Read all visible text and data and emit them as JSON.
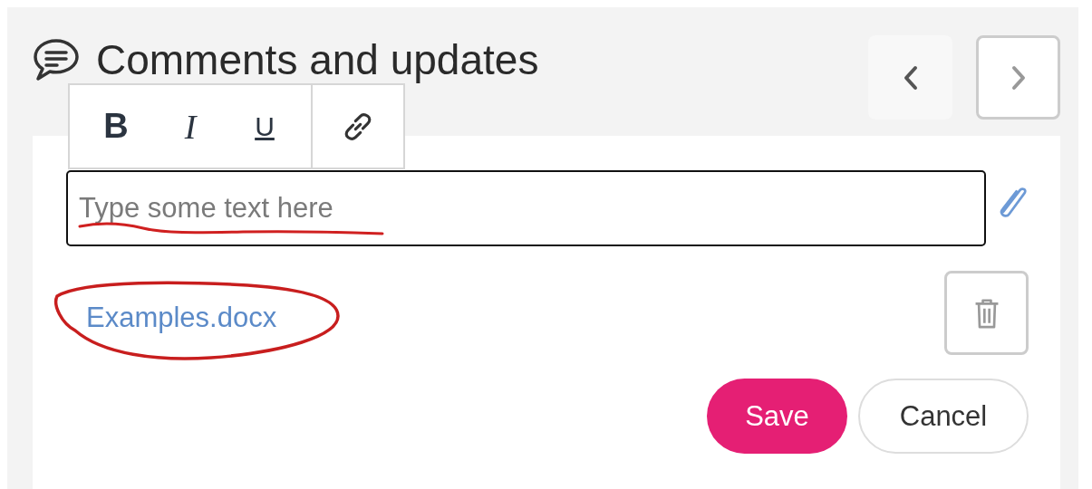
{
  "header": {
    "title": "Comments and updates"
  },
  "toolbar": {
    "format_buttons": [
      {
        "label": "B",
        "kind": "bold"
      },
      {
        "label": "I",
        "kind": "italic"
      },
      {
        "label": "U",
        "kind": "underline"
      }
    ]
  },
  "comment": {
    "placeholder": "Type some text here"
  },
  "attachment": {
    "file_name": "Examples.docx"
  },
  "buttons": [
    {
      "label": "Save",
      "kind": "primary"
    },
    {
      "label": "Cancel",
      "kind": "secondary"
    }
  ]
}
